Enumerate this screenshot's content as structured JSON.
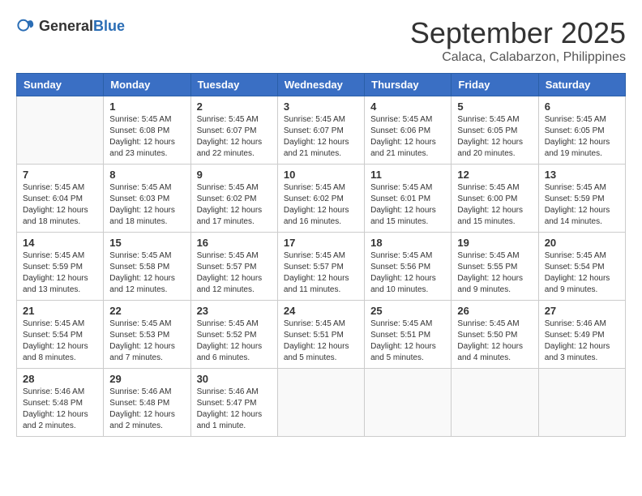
{
  "header": {
    "logo_general": "General",
    "logo_blue": "Blue",
    "title": "September 2025",
    "location": "Calaca, Calabarzon, Philippines"
  },
  "days_of_week": [
    "Sunday",
    "Monday",
    "Tuesday",
    "Wednesday",
    "Thursday",
    "Friday",
    "Saturday"
  ],
  "weeks": [
    [
      {
        "day": "",
        "info": ""
      },
      {
        "day": "1",
        "info": "Sunrise: 5:45 AM\nSunset: 6:08 PM\nDaylight: 12 hours\nand 23 minutes."
      },
      {
        "day": "2",
        "info": "Sunrise: 5:45 AM\nSunset: 6:07 PM\nDaylight: 12 hours\nand 22 minutes."
      },
      {
        "day": "3",
        "info": "Sunrise: 5:45 AM\nSunset: 6:07 PM\nDaylight: 12 hours\nand 21 minutes."
      },
      {
        "day": "4",
        "info": "Sunrise: 5:45 AM\nSunset: 6:06 PM\nDaylight: 12 hours\nand 21 minutes."
      },
      {
        "day": "5",
        "info": "Sunrise: 5:45 AM\nSunset: 6:05 PM\nDaylight: 12 hours\nand 20 minutes."
      },
      {
        "day": "6",
        "info": "Sunrise: 5:45 AM\nSunset: 6:05 PM\nDaylight: 12 hours\nand 19 minutes."
      }
    ],
    [
      {
        "day": "7",
        "info": "Sunrise: 5:45 AM\nSunset: 6:04 PM\nDaylight: 12 hours\nand 18 minutes."
      },
      {
        "day": "8",
        "info": "Sunrise: 5:45 AM\nSunset: 6:03 PM\nDaylight: 12 hours\nand 18 minutes."
      },
      {
        "day": "9",
        "info": "Sunrise: 5:45 AM\nSunset: 6:02 PM\nDaylight: 12 hours\nand 17 minutes."
      },
      {
        "day": "10",
        "info": "Sunrise: 5:45 AM\nSunset: 6:02 PM\nDaylight: 12 hours\nand 16 minutes."
      },
      {
        "day": "11",
        "info": "Sunrise: 5:45 AM\nSunset: 6:01 PM\nDaylight: 12 hours\nand 15 minutes."
      },
      {
        "day": "12",
        "info": "Sunrise: 5:45 AM\nSunset: 6:00 PM\nDaylight: 12 hours\nand 15 minutes."
      },
      {
        "day": "13",
        "info": "Sunrise: 5:45 AM\nSunset: 5:59 PM\nDaylight: 12 hours\nand 14 minutes."
      }
    ],
    [
      {
        "day": "14",
        "info": "Sunrise: 5:45 AM\nSunset: 5:59 PM\nDaylight: 12 hours\nand 13 minutes."
      },
      {
        "day": "15",
        "info": "Sunrise: 5:45 AM\nSunset: 5:58 PM\nDaylight: 12 hours\nand 12 minutes."
      },
      {
        "day": "16",
        "info": "Sunrise: 5:45 AM\nSunset: 5:57 PM\nDaylight: 12 hours\nand 12 minutes."
      },
      {
        "day": "17",
        "info": "Sunrise: 5:45 AM\nSunset: 5:57 PM\nDaylight: 12 hours\nand 11 minutes."
      },
      {
        "day": "18",
        "info": "Sunrise: 5:45 AM\nSunset: 5:56 PM\nDaylight: 12 hours\nand 10 minutes."
      },
      {
        "day": "19",
        "info": "Sunrise: 5:45 AM\nSunset: 5:55 PM\nDaylight: 12 hours\nand 9 minutes."
      },
      {
        "day": "20",
        "info": "Sunrise: 5:45 AM\nSunset: 5:54 PM\nDaylight: 12 hours\nand 9 minutes."
      }
    ],
    [
      {
        "day": "21",
        "info": "Sunrise: 5:45 AM\nSunset: 5:54 PM\nDaylight: 12 hours\nand 8 minutes."
      },
      {
        "day": "22",
        "info": "Sunrise: 5:45 AM\nSunset: 5:53 PM\nDaylight: 12 hours\nand 7 minutes."
      },
      {
        "day": "23",
        "info": "Sunrise: 5:45 AM\nSunset: 5:52 PM\nDaylight: 12 hours\nand 6 minutes."
      },
      {
        "day": "24",
        "info": "Sunrise: 5:45 AM\nSunset: 5:51 PM\nDaylight: 12 hours\nand 5 minutes."
      },
      {
        "day": "25",
        "info": "Sunrise: 5:45 AM\nSunset: 5:51 PM\nDaylight: 12 hours\nand 5 minutes."
      },
      {
        "day": "26",
        "info": "Sunrise: 5:45 AM\nSunset: 5:50 PM\nDaylight: 12 hours\nand 4 minutes."
      },
      {
        "day": "27",
        "info": "Sunrise: 5:46 AM\nSunset: 5:49 PM\nDaylight: 12 hours\nand 3 minutes."
      }
    ],
    [
      {
        "day": "28",
        "info": "Sunrise: 5:46 AM\nSunset: 5:48 PM\nDaylight: 12 hours\nand 2 minutes."
      },
      {
        "day": "29",
        "info": "Sunrise: 5:46 AM\nSunset: 5:48 PM\nDaylight: 12 hours\nand 2 minutes."
      },
      {
        "day": "30",
        "info": "Sunrise: 5:46 AM\nSunset: 5:47 PM\nDaylight: 12 hours\nand 1 minute."
      },
      {
        "day": "",
        "info": ""
      },
      {
        "day": "",
        "info": ""
      },
      {
        "day": "",
        "info": ""
      },
      {
        "day": "",
        "info": ""
      }
    ]
  ]
}
